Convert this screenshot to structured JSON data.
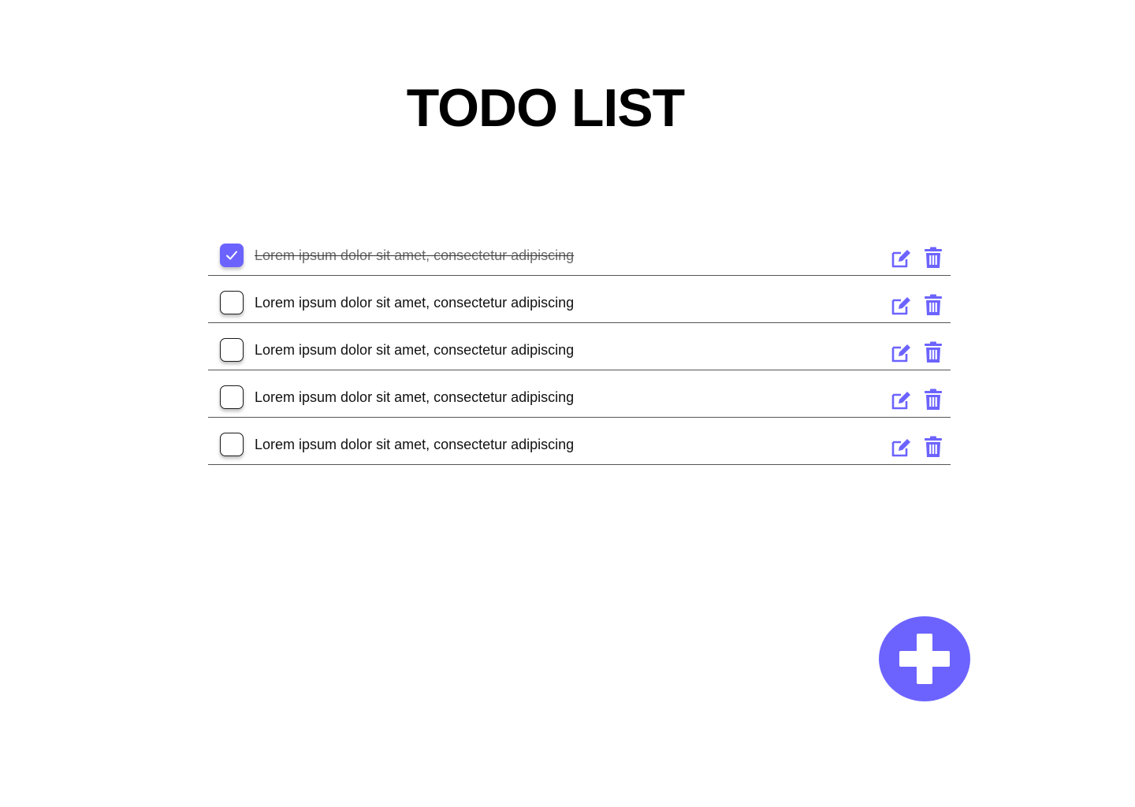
{
  "header": {
    "title": "TODO LIST"
  },
  "colors": {
    "accent": "#6c63ff",
    "text": "#111111",
    "done_text": "#6b6b6b",
    "divider": "#555555"
  },
  "todos": [
    {
      "text": "Lorem ipsum dolor sit amet, consectetur adipiscing",
      "done": true
    },
    {
      "text": "Lorem ipsum dolor sit amet, consectetur adipiscing",
      "done": false
    },
    {
      "text": "Lorem ipsum dolor sit amet, consectetur adipiscing",
      "done": false
    },
    {
      "text": "Lorem ipsum dolor sit amet, consectetur adipiscing",
      "done": false
    },
    {
      "text": "Lorem ipsum dolor sit amet, consectetur adipiscing",
      "done": false
    }
  ],
  "icons": {
    "check": "check-icon",
    "edit": "edit-icon",
    "delete": "trash-icon",
    "add": "plus-icon"
  }
}
